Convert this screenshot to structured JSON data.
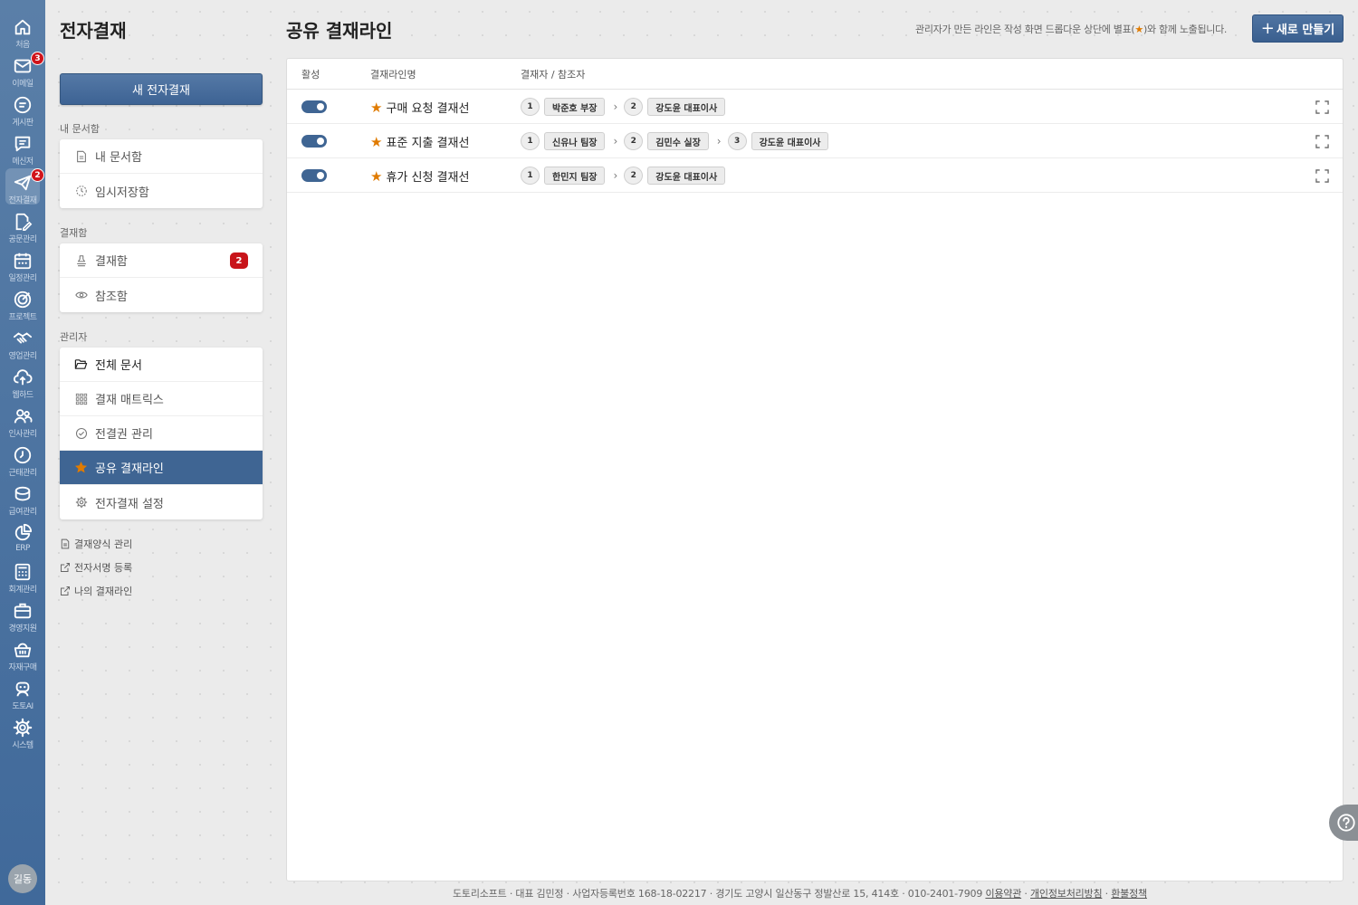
{
  "rail": {
    "items": [
      {
        "label": "처음",
        "icon": "home-icon"
      },
      {
        "label": "이메일",
        "icon": "mail-icon",
        "badge": "3"
      },
      {
        "label": "게시판",
        "icon": "board-icon"
      },
      {
        "label": "메신저",
        "icon": "messenger-icon"
      },
      {
        "label": "전자결재",
        "icon": "approval-icon",
        "badge": "2"
      },
      {
        "label": "공문관리",
        "icon": "document-edit-icon"
      },
      {
        "label": "일정관리",
        "icon": "calendar-icon"
      },
      {
        "label": "프로젝트",
        "icon": "target-icon"
      },
      {
        "label": "영업관리",
        "icon": "handshake-icon"
      },
      {
        "label": "웹하드",
        "icon": "cloud-upload-icon"
      },
      {
        "label": "인사관리",
        "icon": "people-icon"
      },
      {
        "label": "근태관리",
        "icon": "clock-icon"
      },
      {
        "label": "급여관리",
        "icon": "coins-icon"
      },
      {
        "label": "ERP",
        "icon": "pie-chart-icon"
      },
      {
        "label": "회계관리",
        "icon": "calculator-icon"
      },
      {
        "label": "경영지원",
        "icon": "briefcase-icon"
      },
      {
        "label": "자재구매",
        "icon": "basket-icon"
      },
      {
        "label": "도토AI",
        "icon": "robot-icon"
      },
      {
        "label": "시스템",
        "icon": "gear-icon"
      }
    ],
    "avatar": "길동"
  },
  "sidebar": {
    "title": "전자결재",
    "new_button": "새 전자결재",
    "groups": [
      {
        "label": "내 문서함",
        "items": [
          {
            "label": "내 문서함",
            "icon": "file-icon"
          },
          {
            "label": "임시저장함",
            "icon": "clock-dashed-icon"
          }
        ]
      },
      {
        "label": "결재함",
        "items": [
          {
            "label": "결재함",
            "icon": "stamp-icon",
            "badge": "2"
          },
          {
            "label": "참조함",
            "icon": "eye-icon"
          }
        ]
      },
      {
        "label": "관리자",
        "items": [
          {
            "label": "전체 문서",
            "icon": "folder-open-icon"
          },
          {
            "label": "결재 매트릭스",
            "icon": "grid-icon"
          },
          {
            "label": "전결권 관리",
            "icon": "check-circle-icon"
          },
          {
            "label": "공유 결재라인",
            "icon": "star-icon"
          },
          {
            "label": "전자결재 설정",
            "icon": "gear-icon"
          }
        ]
      }
    ],
    "links": [
      {
        "label": "결재양식 관리",
        "icon": "file-text-icon"
      },
      {
        "label": "전자서명 등록",
        "icon": "external-link-icon"
      },
      {
        "label": "나의 결재라인",
        "icon": "external-link-icon"
      }
    ]
  },
  "main": {
    "title": "공유 결재라인",
    "hint_before": "관리자가 만든 라인은 작성 화면 드롭다운 상단에 별표(",
    "hint_after": ")와 함께 노출됩니다.",
    "create_button": "새로 만들기",
    "columns": [
      "활성",
      "결재라인명",
      "결재자 / 참조자"
    ],
    "rows": [
      {
        "name": "구매 요청 결재선",
        "active": true,
        "steps": [
          {
            "order": "1",
            "person": "박준호 부장"
          },
          {
            "order": "2",
            "person": "강도윤 대표이사"
          }
        ]
      },
      {
        "name": "표준 지출 결재선",
        "active": true,
        "steps": [
          {
            "order": "1",
            "person": "신유나 팀장"
          },
          {
            "order": "2",
            "person": "김민수 실장"
          },
          {
            "order": "3",
            "person": "강도윤 대표이사"
          }
        ]
      },
      {
        "name": "휴가 신청 결재선",
        "active": true,
        "steps": [
          {
            "order": "1",
            "person": "한민지 팀장"
          },
          {
            "order": "2",
            "person": "강도윤 대표이사"
          }
        ]
      }
    ]
  },
  "footer": {
    "text": "도토리소프트 · 대표 김민정 · 사업자등록번호 168-18-02217 · 경기도 고양시 일산동구 정발산로 15, 414호 · 010-2401-7909 ",
    "links": [
      "이용약관",
      "개인정보처리방침",
      "환불정책"
    ]
  },
  "colors": {
    "accent": "#3f6593",
    "star": "#e07b00",
    "badge": "#c8141a"
  }
}
